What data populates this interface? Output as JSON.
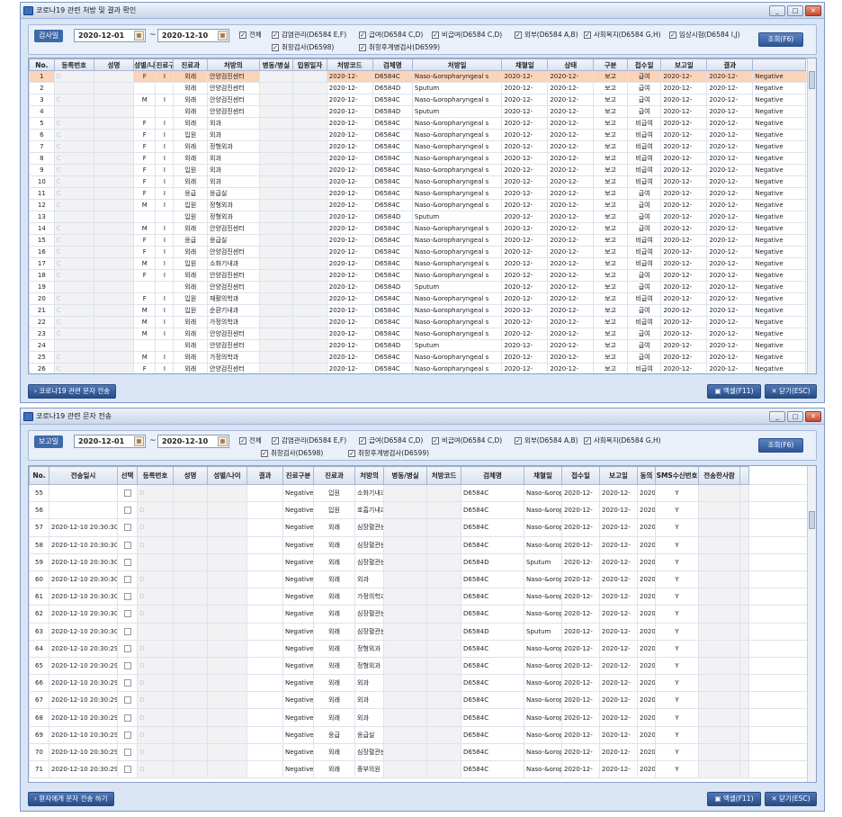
{
  "win1": {
    "title": "코로나19 관련 처방 및 결과 확인",
    "filter_label": "검사일",
    "date_from": "2020-12-01",
    "date_to": "2020-12-10",
    "tilde": "~",
    "checks": [
      "전체",
      "감염관리(D6584 E,F)",
      "급여(D6584 C,D)",
      "비급여(D6584 C,D)",
      "외부(D6584 A,B)",
      "사회복지(D6584 G,H)",
      "임상시험(D6584 I,J)",
      "취항검사(D6598)",
      "취항후계병검사(D6599)"
    ],
    "search_btn": "조회(F6)",
    "columns": [
      "No.",
      "등록번호",
      "성명",
      "성별/나이",
      "진료구분",
      "진료과",
      "처방의",
      "병동/병실",
      "입원일자",
      "처방코드",
      "검체명",
      "처방일",
      "채혈일",
      "상태",
      "구분",
      "접수일",
      "보고일",
      "결과"
    ],
    "rows": [
      [
        "1",
        "D",
        "",
        "F",
        "I",
        "외래",
        "안양검진센터",
        "",
        "",
        "2020-12-",
        "D6584C",
        "Naso-&oropharyngeal s",
        "2020-12-",
        "2020-12-",
        "보고",
        "급여",
        "2020-12-",
        "2020-12-",
        "Negative"
      ],
      [
        "2",
        "",
        "",
        "",
        "",
        "외래",
        "안양검진센터",
        "",
        "",
        "2020-12-",
        "D6584D",
        "Sputum",
        "2020-12-",
        "2020-12-",
        "보고",
        "급여",
        "2020-12-",
        "2020-12-",
        "Negative"
      ],
      [
        "3",
        "C",
        "",
        "M",
        "I",
        "외래",
        "안양검진센터",
        "",
        "",
        "2020-12-",
        "D6584C",
        "Naso-&oropharyngeal s",
        "2020-12-",
        "2020-12-",
        "보고",
        "급여",
        "2020-12-",
        "2020-12-",
        "Negative"
      ],
      [
        "4",
        "",
        "",
        "",
        "",
        "외래",
        "안양검진센터",
        "",
        "",
        "2020-12-",
        "D6584D",
        "Sputum",
        "2020-12-",
        "2020-12-",
        "보고",
        "급여",
        "2020-12-",
        "2020-12-",
        "Negative"
      ],
      [
        "5",
        "C",
        "",
        "F",
        "I",
        "외래",
        "외과",
        "",
        "",
        "2020-12-",
        "D6584C",
        "Naso-&oropharyngeal s",
        "2020-12-",
        "2020-12-",
        "보고",
        "비급여",
        "2020-12-",
        "2020-12-",
        "Negative"
      ],
      [
        "6",
        "C",
        "",
        "F",
        "I",
        "입원",
        "외과",
        "",
        "",
        "2020-12-",
        "D6584C",
        "Naso-&oropharyngeal s",
        "2020-12-",
        "2020-12-",
        "보고",
        "비급여",
        "2020-12-",
        "2020-12-",
        "Negative"
      ],
      [
        "7",
        "C",
        "",
        "F",
        "I",
        "외래",
        "정형외과",
        "",
        "",
        "2020-12-",
        "D6584C",
        "Naso-&oropharyngeal s",
        "2020-12-",
        "2020-12-",
        "보고",
        "비급여",
        "2020-12-",
        "2020-12-",
        "Negative"
      ],
      [
        "8",
        "C",
        "",
        "F",
        "I",
        "외래",
        "외과",
        "",
        "",
        "2020-12-",
        "D6584C",
        "Naso-&oropharyngeal s",
        "2020-12-",
        "2020-12-",
        "보고",
        "비급여",
        "2020-12-",
        "2020-12-",
        "Negative"
      ],
      [
        "9",
        "C",
        "",
        "F",
        "I",
        "입원",
        "외과",
        "",
        "",
        "2020-12-",
        "D6584C",
        "Naso-&oropharyngeal s",
        "2020-12-",
        "2020-12-",
        "보고",
        "비급여",
        "2020-12-",
        "2020-12-",
        "Negative"
      ],
      [
        "10",
        "C",
        "",
        "F",
        "I",
        "외래",
        "외과",
        "",
        "",
        "2020-12-",
        "D6584C",
        "Naso-&oropharyngeal s",
        "2020-12-",
        "2020-12-",
        "보고",
        "비급여",
        "2020-12-",
        "2020-12-",
        "Negative"
      ],
      [
        "11",
        "C",
        "",
        "F",
        "I",
        "응급",
        "응급실",
        "",
        "",
        "2020-12-",
        "D6584C",
        "Naso-&oropharyngeal s",
        "2020-12-",
        "2020-12-",
        "보고",
        "급여",
        "2020-12-",
        "2020-12-",
        "Negative"
      ],
      [
        "12",
        "C",
        "",
        "M",
        "I",
        "입원",
        "정형외과",
        "",
        "",
        "2020-12-",
        "D6584C",
        "Naso-&oropharyngeal s",
        "2020-12-",
        "2020-12-",
        "보고",
        "급여",
        "2020-12-",
        "2020-12-",
        "Negative"
      ],
      [
        "13",
        "",
        "",
        "",
        "",
        "입원",
        "정형외과",
        "",
        "",
        "2020-12-",
        "D6584D",
        "Sputum",
        "2020-12-",
        "2020-12-",
        "보고",
        "급여",
        "2020-12-",
        "2020-12-",
        "Negative"
      ],
      [
        "14",
        "C",
        "",
        "M",
        "I",
        "외래",
        "안양검진센터",
        "",
        "",
        "2020-12-",
        "D6584C",
        "Naso-&oropharyngeal s",
        "2020-12-",
        "2020-12-",
        "보고",
        "급여",
        "2020-12-",
        "2020-12-",
        "Negative"
      ],
      [
        "15",
        "C",
        "",
        "F",
        "I",
        "응급",
        "응급실",
        "",
        "",
        "2020-12-",
        "D6584C",
        "Naso-&oropharyngeal s",
        "2020-12-",
        "2020-12-",
        "보고",
        "비급여",
        "2020-12-",
        "2020-12-",
        "Negative"
      ],
      [
        "16",
        "C",
        "",
        "F",
        "I",
        "외래",
        "안양검진센터",
        "",
        "",
        "2020-12-",
        "D6584C",
        "Naso-&oropharyngeal s",
        "2020-12-",
        "2020-12-",
        "보고",
        "비급여",
        "2020-12-",
        "2020-12-",
        "Negative"
      ],
      [
        "17",
        "C",
        "",
        "M",
        "I",
        "입원",
        "소화기내과",
        "",
        "",
        "2020-12-",
        "D6584C",
        "Naso-&oropharyngeal s",
        "2020-12-",
        "2020-12-",
        "보고",
        "비급여",
        "2020-12-",
        "2020-12-",
        "Negative"
      ],
      [
        "18",
        "C",
        "",
        "F",
        "I",
        "외래",
        "안양검진센터",
        "",
        "",
        "2020-12-",
        "D6584C",
        "Naso-&oropharyngeal s",
        "2020-12-",
        "2020-12-",
        "보고",
        "급여",
        "2020-12-",
        "2020-12-",
        "Negative"
      ],
      [
        "19",
        "",
        "",
        "",
        "",
        "외래",
        "안양검진센터",
        "",
        "",
        "2020-12-",
        "D6584D",
        "Sputum",
        "2020-12-",
        "2020-12-",
        "보고",
        "급여",
        "2020-12-",
        "2020-12-",
        "Negative"
      ],
      [
        "20",
        "C",
        "",
        "F",
        "I",
        "입원",
        "재활의학과",
        "",
        "",
        "2020-12-",
        "D6584C",
        "Naso-&oropharyngeal s",
        "2020-12-",
        "2020-12-",
        "보고",
        "비급여",
        "2020-12-",
        "2020-12-",
        "Negative"
      ],
      [
        "21",
        "C",
        "",
        "M",
        "I",
        "입원",
        "순환기내과",
        "",
        "",
        "2020-12-",
        "D6584C",
        "Naso-&oropharyngeal s",
        "2020-12-",
        "2020-12-",
        "보고",
        "급여",
        "2020-12-",
        "2020-12-",
        "Negative"
      ],
      [
        "22",
        "C",
        "",
        "M",
        "I",
        "외래",
        "가정의학과",
        "",
        "",
        "2020-12-",
        "D6584C",
        "Naso-&oropharyngeal s",
        "2020-12-",
        "2020-12-",
        "보고",
        "비급여",
        "2020-12-",
        "2020-12-",
        "Negative"
      ],
      [
        "23",
        "C",
        "",
        "M",
        "I",
        "외래",
        "안양검진센터",
        "",
        "",
        "2020-12-",
        "D6584C",
        "Naso-&oropharyngeal s",
        "2020-12-",
        "2020-12-",
        "보고",
        "급여",
        "2020-12-",
        "2020-12-",
        "Negative"
      ],
      [
        "24",
        "",
        "",
        "",
        "",
        "외래",
        "안양검진센터",
        "",
        "",
        "2020-12-",
        "D6584D",
        "Sputum",
        "2020-12-",
        "2020-12-",
        "보고",
        "급여",
        "2020-12-",
        "2020-12-",
        "Negative"
      ],
      [
        "25",
        "C",
        "",
        "M",
        "I",
        "외래",
        "가정의학과",
        "",
        "",
        "2020-12-",
        "D6584C",
        "Naso-&oropharyngeal s",
        "2020-12-",
        "2020-12-",
        "보고",
        "급여",
        "2020-12-",
        "2020-12-",
        "Negative"
      ],
      [
        "26",
        "C",
        "",
        "F",
        "I",
        "외래",
        "안양검진센터",
        "",
        "",
        "2020-12-",
        "D6584C",
        "Naso-&oropharyngeal s",
        "2020-12-",
        "2020-12-",
        "보고",
        "비급여",
        "2020-12-",
        "2020-12-",
        "Negative"
      ]
    ],
    "send_btn": "코로나19 관련 문자 전송",
    "excel_btn": "엑셀(F11)",
    "close_btn": "닫기(ESC)"
  },
  "win2": {
    "title": "코로나19 관련 문자 전송",
    "filter_label": "보고일",
    "date_from": "2020-12-01",
    "date_to": "2020-12-10",
    "tilde": "~",
    "checks": [
      "전체",
      "감염관리(D6584 E,F)",
      "급여(D6584 C,D)",
      "비급여(D6584 C,D)",
      "외부(D6584 A,B)",
      "사회복지(D6584 G,H)",
      "취항검사(D6598)",
      "취항후계병검사(D6599)"
    ],
    "search_btn": "조회(F6)",
    "columns": [
      "No.",
      "전송일시",
      "선택",
      "등록번호",
      "성명",
      "성별/나이",
      "결과",
      "진료구분",
      "진료과",
      "처방의",
      "병동/병실",
      "처방코드",
      "검체명",
      "채혈일",
      "접수일",
      "보고일",
      "동의",
      "SMS수신번호",
      "전송한사람"
    ],
    "rows": [
      [
        "55",
        "",
        "",
        "D",
        "",
        "",
        "",
        "Negative",
        "입원",
        "소화기내과",
        "",
        "",
        "D6584C",
        "Naso-&oropharyng",
        "2020-12-",
        "2020-12-",
        "2020-12-",
        "Y",
        "",
        ""
      ],
      [
        "56",
        "",
        "",
        "D",
        "",
        "",
        "",
        "Negative",
        "입원",
        "호흡기내과",
        "",
        "",
        "D6584C",
        "Naso-&oropharyng",
        "2020-12-",
        "2020-12-",
        "2020-12-",
        "Y",
        "",
        ""
      ],
      [
        "57",
        "2020-12-10 20:30:30",
        "",
        "D",
        "",
        "",
        "",
        "Negative",
        "외래",
        "심장혈관센터",
        "",
        "",
        "D6584C",
        "Naso-&oropharyng",
        "2020-12-",
        "2020-12-",
        "2020-12-",
        "Y",
        "",
        ""
      ],
      [
        "58",
        "2020-12-10 20:30:30",
        "",
        "D",
        "",
        "",
        "",
        "Negative",
        "외래",
        "심장혈관센터",
        "",
        "",
        "D6584C",
        "Naso-&oropharyng",
        "2020-12-",
        "2020-12-",
        "2020-12-",
        "Y",
        "",
        ""
      ],
      [
        "59",
        "2020-12-10 20:30:30",
        "",
        "",
        "",
        "",
        "",
        "Negative",
        "외래",
        "심장혈관센터",
        "",
        "",
        "D6584D",
        "Sputum",
        "2020-12-",
        "2020-12-",
        "2020-12-",
        "Y",
        "",
        ""
      ],
      [
        "60",
        "2020-12-10 20:30:30",
        "",
        "D",
        "",
        "",
        "",
        "Negative",
        "외래",
        "외과",
        "",
        "",
        "D6584C",
        "Naso-&oropharyng",
        "2020-12-",
        "2020-12-",
        "2020-12-",
        "Y",
        "",
        ""
      ],
      [
        "61",
        "2020-12-10 20:30:30",
        "",
        "D",
        "",
        "",
        "",
        "Negative",
        "외래",
        "가정의학과",
        "",
        "",
        "D6584C",
        "Naso-&oropharyng",
        "2020-12-",
        "2020-12-",
        "2020-12-",
        "Y",
        "",
        ""
      ],
      [
        "62",
        "2020-12-10 20:30:30",
        "",
        "D",
        "",
        "",
        "",
        "Negative",
        "외래",
        "심장혈관센터",
        "",
        "",
        "D6584C",
        "Naso-&oropharyng",
        "2020-12-",
        "2020-12-",
        "2020-12-",
        "Y",
        "",
        ""
      ],
      [
        "63",
        "2020-12-10 20:30:30",
        "",
        "",
        "",
        "",
        "",
        "Negative",
        "외래",
        "심장혈관센터",
        "",
        "",
        "D6584D",
        "Sputum",
        "2020-12-",
        "2020-12-",
        "2020-12-",
        "Y",
        "",
        ""
      ],
      [
        "64",
        "2020-12-10 20:30:29",
        "",
        "D",
        "",
        "",
        "",
        "Negative",
        "외래",
        "정형외과",
        "",
        "",
        "D6584C",
        "Naso-&oropharyng",
        "2020-12-",
        "2020-12-",
        "2020-12-",
        "Y",
        "",
        ""
      ],
      [
        "65",
        "2020-12-10 20:30:29",
        "",
        "D",
        "",
        "",
        "",
        "Negative",
        "외래",
        "정형외과",
        "",
        "",
        "D6584C",
        "Naso-&oropharyng",
        "2020-12-",
        "2020-12-",
        "2020-12-",
        "Y",
        "",
        ""
      ],
      [
        "66",
        "2020-12-10 20:30:29",
        "",
        "D",
        "",
        "",
        "",
        "Negative",
        "외래",
        "외과",
        "",
        "",
        "D6584C",
        "Naso-&oropharyng",
        "2020-12-",
        "2020-12-",
        "2020-12-",
        "Y",
        "",
        ""
      ],
      [
        "67",
        "2020-12-10 20:30:29",
        "",
        "D",
        "",
        "",
        "",
        "Negative",
        "외래",
        "외과",
        "",
        "",
        "D6584C",
        "Naso-&oropharyng",
        "2020-12-",
        "2020-12-",
        "2020-12-",
        "Y",
        "",
        ""
      ],
      [
        "68",
        "2020-12-10 20:30:29",
        "",
        "D",
        "",
        "",
        "",
        "Negative",
        "외래",
        "외과",
        "",
        "",
        "D6584C",
        "Naso-&oropharyng",
        "2020-12-",
        "2020-12-",
        "2020-12-",
        "Y",
        "",
        ""
      ],
      [
        "69",
        "2020-12-10 20:30:29",
        "",
        "D",
        "",
        "",
        "",
        "Negative",
        "응급",
        "응급실",
        "",
        "",
        "D6584C",
        "Naso-&oropharyng",
        "2020-12-",
        "2020-12-",
        "2020-12-",
        "Y",
        "",
        ""
      ],
      [
        "70",
        "2020-12-10 20:30:29",
        "",
        "D",
        "",
        "",
        "",
        "Negative",
        "외래",
        "심장혈관센터",
        "",
        "",
        "D6584C",
        "Naso-&oropharyng",
        "2020-12-",
        "2020-12-",
        "2020-12-",
        "Y",
        "",
        ""
      ],
      [
        "71",
        "2020-12-10 20:30:29",
        "",
        "D",
        "",
        "",
        "",
        "Negative",
        "외래",
        "중부의원",
        "",
        "",
        "D6584C",
        "Naso-&oropharyng",
        "2020-12-",
        "2020-12-",
        "2020-12-",
        "Y",
        "",
        ""
      ]
    ],
    "send_btn": "환자에게 문자 전송 하기",
    "excel_btn": "엑셀(F11)",
    "close_btn": "닫기(ESC)"
  }
}
